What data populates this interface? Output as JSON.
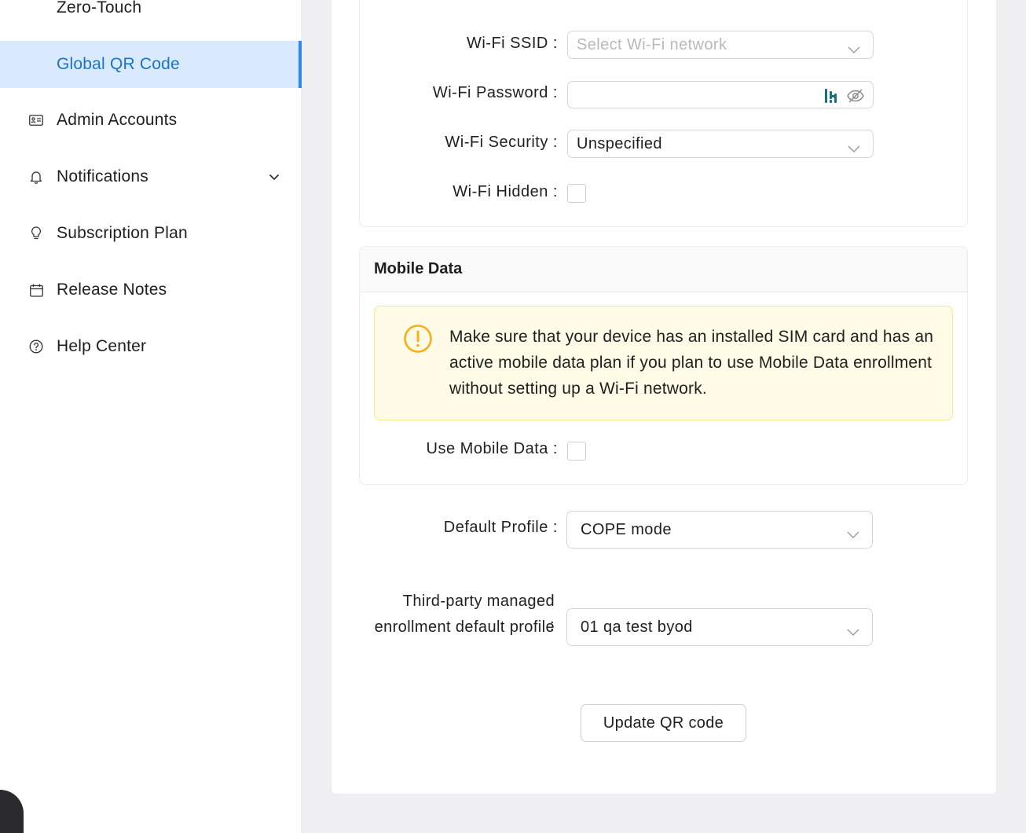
{
  "sidebar": {
    "sub_items": [
      {
        "label": "Zero-Touch"
      },
      {
        "label": "Global QR Code"
      }
    ],
    "items": [
      {
        "label": "Admin Accounts",
        "icon": "id-card-icon"
      },
      {
        "label": "Notifications",
        "icon": "bell-icon"
      },
      {
        "label": "Subscription Plan",
        "icon": "lightbulb-icon"
      },
      {
        "label": "Release Notes",
        "icon": "calendar-icon"
      },
      {
        "label": "Help Center",
        "icon": "question-circle-icon"
      }
    ],
    "active_color": "#1a73c9"
  },
  "wifi": {
    "ssid_label": "Wi-Fi SSID",
    "ssid_placeholder": "Select Wi-Fi network",
    "password_label": "Wi-Fi Password",
    "password_value": "",
    "security_label": "Wi-Fi Security",
    "security_value": "Unspecified",
    "hidden_label": "Wi-Fi Hidden",
    "hidden_checked": false
  },
  "mobile": {
    "title": "Mobile Data",
    "alert_text": "Make sure that your device has an installed SIM card and has an active mobile data plan if you plan to use Mobile Data enrollment without setting up a Wi-Fi network.",
    "use_label": "Use Mobile Data",
    "use_checked": false,
    "alert_color": "#faad14"
  },
  "profile": {
    "default_label": "Default Profile",
    "default_value": "COPE mode",
    "third_party_label": "Third-party managed enrollment default profile",
    "third_party_value": "01 qa test byod"
  },
  "actions": {
    "update_label": "Update QR code"
  }
}
